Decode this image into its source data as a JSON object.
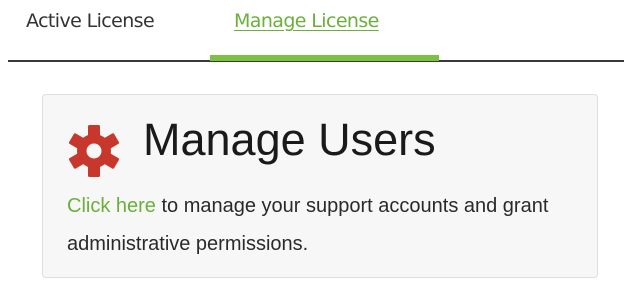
{
  "tabs": [
    {
      "label": "Active License",
      "active": false
    },
    {
      "label": "Manage License",
      "active": true
    }
  ],
  "card": {
    "icon": "gear-icon",
    "title": "Manage Users",
    "link_text": "Click here",
    "description": " to manage your support accounts and grant administrative permissions."
  },
  "colors": {
    "accent": "#7cc242",
    "link": "#6ab03a",
    "icon": "#c8372b"
  }
}
